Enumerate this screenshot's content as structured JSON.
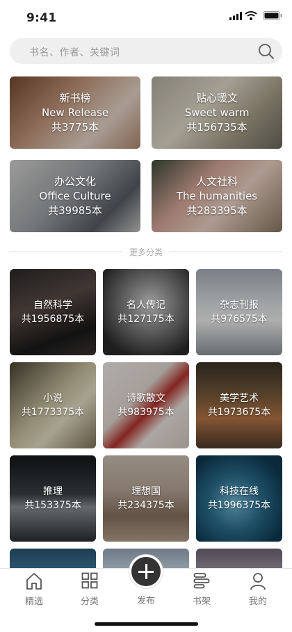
{
  "status": {
    "time": "9:41"
  },
  "search": {
    "placeholder": "书名、作者、关键词"
  },
  "featured": [
    {
      "cn": "新书榜",
      "en": "New Release",
      "count": "共3775本"
    },
    {
      "cn": "贴心暖文",
      "en": "Sweet warm",
      "count": "共156735本"
    },
    {
      "cn": "办公文化",
      "en": "Office Culture",
      "count": "共39985本"
    },
    {
      "cn": "人文社科",
      "en": "The humanities",
      "count": "共283395本"
    }
  ],
  "more_label": "更多分类",
  "categories": [
    {
      "name": "自然科学",
      "count": "共1956875本"
    },
    {
      "name": "名人传记",
      "count": "共127175本"
    },
    {
      "name": "杂志刊报",
      "count": "共976575本"
    },
    {
      "name": "小说",
      "count": "共1773375本"
    },
    {
      "name": "诗歌散文",
      "count": "共983975本"
    },
    {
      "name": "美学艺术",
      "count": "共1973675本"
    },
    {
      "name": "推理",
      "count": "共153375本"
    },
    {
      "name": "理想国",
      "count": "共234375本"
    },
    {
      "name": "科技在线",
      "count": "共1996375本"
    }
  ],
  "tabs": [
    {
      "label": "精选",
      "icon": "home-icon"
    },
    {
      "label": "分类",
      "icon": "grid-icon"
    },
    {
      "label": "发布",
      "icon": "plus-icon"
    },
    {
      "label": "书架",
      "icon": "bookshelf-icon"
    },
    {
      "label": "我的",
      "icon": "user-icon"
    }
  ]
}
